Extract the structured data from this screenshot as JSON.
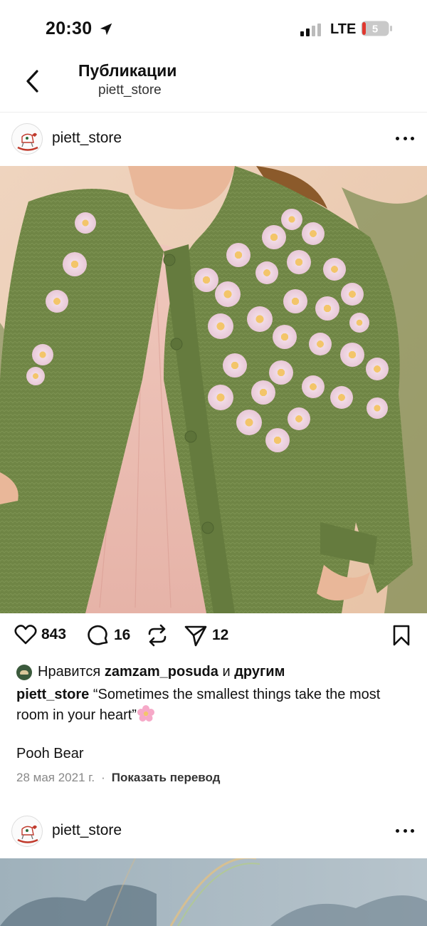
{
  "status": {
    "time": "20:30",
    "network": "LTE",
    "battery": "5",
    "icons": [
      "location-arrow-icon",
      "signal-bars-icon",
      "battery-icon"
    ]
  },
  "header": {
    "title": "Публикации",
    "subtitle": "piett_store",
    "back_icon": "chevron-left-icon"
  },
  "posts": [
    {
      "username": "piett_store",
      "more_icon": "more-horizontal-icon",
      "likes": "843",
      "comments": "16",
      "shares": "12",
      "liked_by_prefix": "Нравится",
      "liked_by_user": "zamzam_posuda",
      "liked_by_join": "и",
      "liked_by_others": "другим",
      "caption_user": "piett_store",
      "caption_text": "“Sometimes the smallest things take the most room in your heart”",
      "caption_emoji": "cherry-blossom-icon",
      "extra_line": "Pooh Bear",
      "date": "28 мая 2021 г.",
      "meta_separator": "·",
      "translate": "Показать перевод"
    },
    {
      "username": "piett_store",
      "more_icon": "more-horizontal-icon"
    }
  ],
  "colors": {
    "text": "#111111",
    "muted": "#888888",
    "cardigan": "#6f8545",
    "dress": "#edbfb6",
    "background": "#f1d6c2"
  }
}
